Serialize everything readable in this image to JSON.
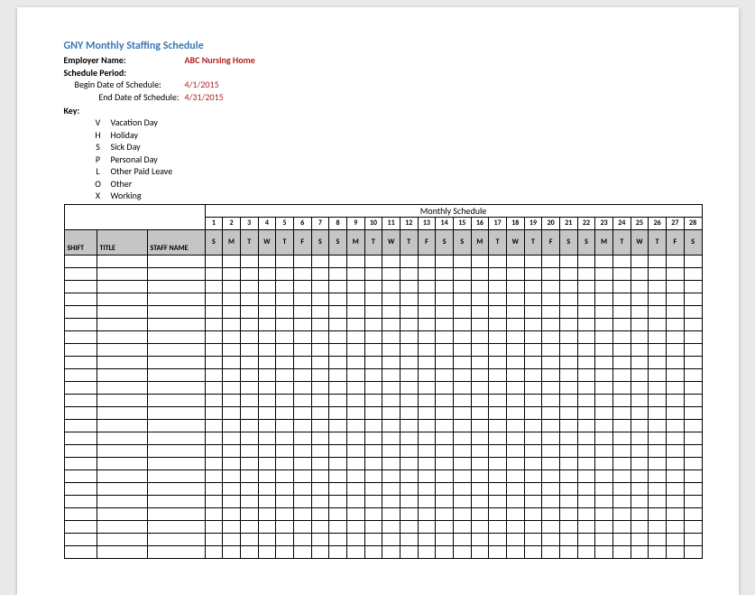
{
  "title": "GNY Monthly Staffing Schedule",
  "fields": {
    "employer_label": "Employer Name:",
    "employer_value": "ABC Nursing Home",
    "period_label": "Schedule Period:",
    "begin_label": "Begin Date of Schedule:",
    "begin_value": "4/1/2015",
    "end_label": "End Date of Schedule:",
    "end_value": "4/31/2015",
    "key_label": "Key:"
  },
  "key": [
    {
      "code": "V",
      "desc": "Vacation Day"
    },
    {
      "code": "H",
      "desc": "Holiday"
    },
    {
      "code": "S",
      "desc": "Sick Day"
    },
    {
      "code": "P",
      "desc": "Personal Day"
    },
    {
      "code": "L",
      "desc": "Other Paid Leave"
    },
    {
      "code": "O",
      "desc": "Other"
    },
    {
      "code": "X",
      "desc": "Working"
    }
  ],
  "table": {
    "monthly_header": "Monthly Schedule",
    "col_headers": {
      "shift": "SHIFT",
      "title": "TITLE",
      "staff": "STAFF NAME"
    },
    "day_numbers": [
      "1",
      "2",
      "3",
      "4",
      "5",
      "6",
      "7",
      "8",
      "9",
      "10",
      "11",
      "12",
      "13",
      "14",
      "15",
      "16",
      "17",
      "18",
      "19",
      "20",
      "21",
      "22",
      "23",
      "24",
      "25",
      "26",
      "27",
      "28"
    ],
    "day_weekdays": [
      "S",
      "M",
      "T",
      "W",
      "T",
      "F",
      "S",
      "S",
      "M",
      "T",
      "W",
      "T",
      "F",
      "S",
      "S",
      "M",
      "T",
      "W",
      "T",
      "F",
      "S",
      "S",
      "M",
      "T",
      "W",
      "T",
      "F",
      "S"
    ],
    "blank_rows": 24
  }
}
